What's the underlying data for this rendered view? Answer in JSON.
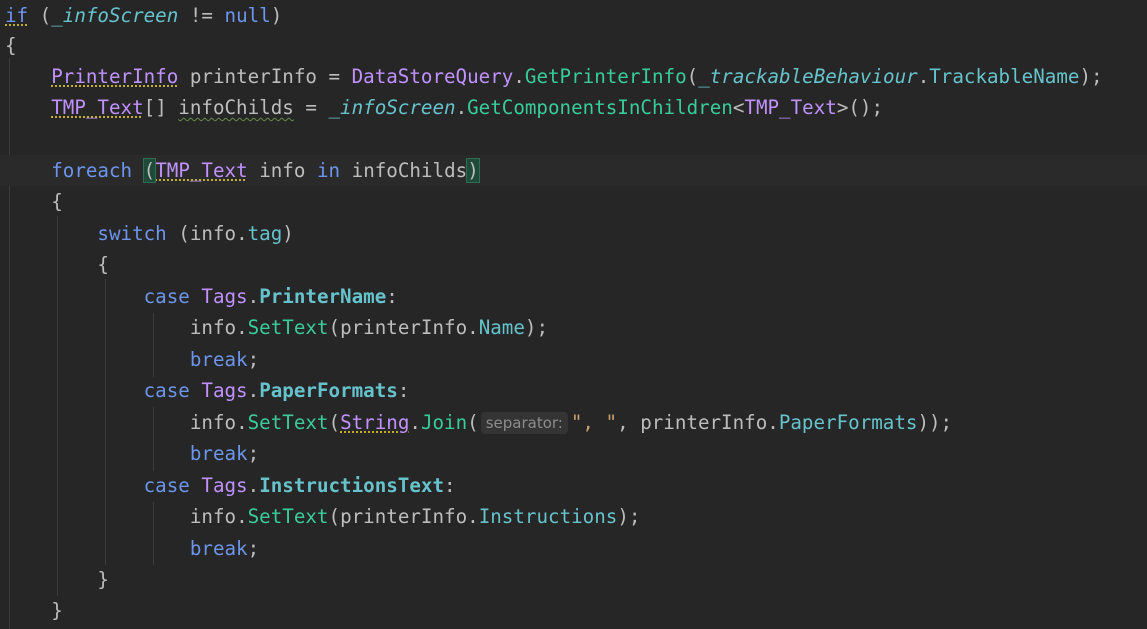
{
  "tokens": {
    "kw_if": "if",
    "info_screen": "_infoScreen",
    "neq": "!=",
    "kw_null": "null",
    "brace_open": "{",
    "brace_close": "}",
    "printer_info_type": "PrinterInfo",
    "printer_info_var": "printerInfo",
    "datastore_query": "DataStoreQuery",
    "get_printer_info": "GetPrinterInfo",
    "trackable_behaviour": "_trackableBehaviour",
    "trackable_name": "TrackableName",
    "tmp_text": "TMP_Text",
    "info_childs": "infoChilds",
    "get_components": "GetComponentsInChildren",
    "kw_foreach": "foreach",
    "info": "info",
    "kw_in": "in",
    "kw_switch": "switch",
    "tag": "tag",
    "kw_case": "case",
    "tags": "Tags",
    "printer_name": "PrinterName",
    "set_text": "SetText",
    "name": "Name",
    "kw_break": "break",
    "paper_formats": "PaperFormats",
    "string_type": "String",
    "join": "Join",
    "separator_hint": "separator:",
    "separator_literal": "\", \"",
    "instructions_text": "InstructionsText",
    "instructions": "Instructions"
  },
  "colors": {
    "background": "#262626",
    "keyword": "#6c95eb",
    "type": "#c191ff",
    "method": "#39cc9b",
    "member": "#66c3cc",
    "string": "#c9a26d",
    "default_text": "#bdbdbd"
  }
}
